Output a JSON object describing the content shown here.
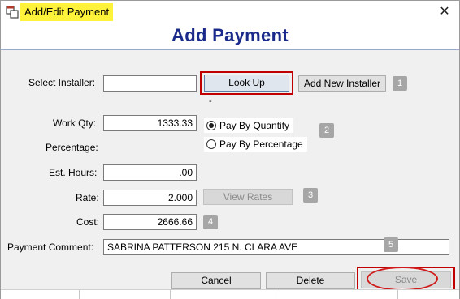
{
  "window": {
    "title": "Add/Edit Payment",
    "close_icon": "close-icon",
    "app_icon": "window-icon"
  },
  "page": {
    "title": "Add Payment"
  },
  "installer": {
    "label": "Select Installer:",
    "value": "",
    "lookup_label": "Look Up",
    "add_new_label": "Add New Installer",
    "dash": "-",
    "badge": "1"
  },
  "work_qty": {
    "label": "Work Qty:",
    "value": "1333.33"
  },
  "percentage": {
    "label": "Percentage:"
  },
  "pay_mode": {
    "options": [
      {
        "label": "Pay By Quantity",
        "selected": true
      },
      {
        "label": "Pay By Percentage",
        "selected": false
      }
    ],
    "badge": "2"
  },
  "est_hours": {
    "label": "Est. Hours:",
    "value": ".00"
  },
  "rate": {
    "label": "Rate:",
    "value": "2.000",
    "view_rates_label": "View Rates",
    "badge": "3"
  },
  "cost": {
    "label": "Cost:",
    "value": "2666.66",
    "badge": "4"
  },
  "comment": {
    "label": "Payment Comment:",
    "value": "SABRINA PATTERSON 215 N. CLARA AVE",
    "badge": "5"
  },
  "actions": {
    "cancel_label": "Cancel",
    "delete_label": "Delete",
    "save_label": "Save"
  },
  "colors": {
    "title_highlight": "#fff23a",
    "heading": "#1a2a8a",
    "annotation_red": "#c00000",
    "badge_gray": "#a6a6a6"
  }
}
